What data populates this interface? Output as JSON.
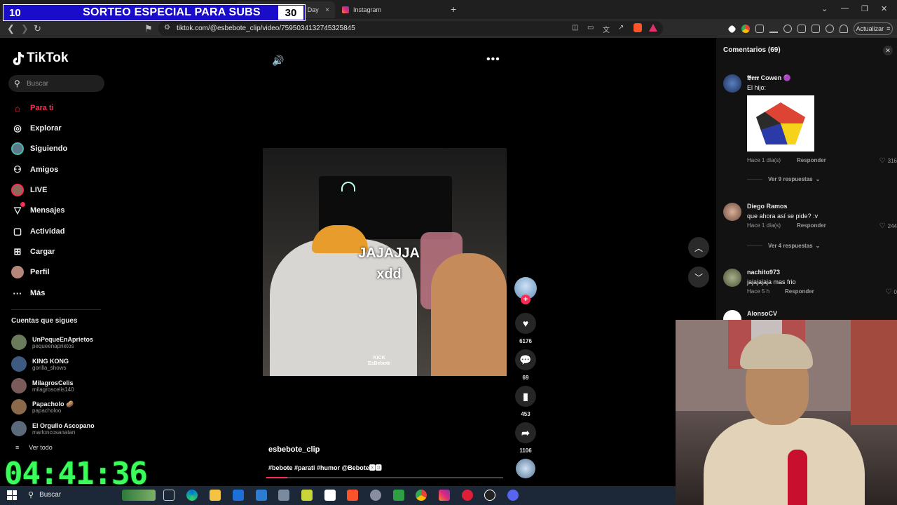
{
  "overlay": {
    "left_number": "10",
    "title": "SORTEO ESPECIAL PARA SUBS",
    "right_number": "30"
  },
  "browser": {
    "tabs": [
      {
        "label": "TikTok - Make Your Day",
        "close": "×",
        "color": "#ffffff"
      },
      {
        "label": "Instagram",
        "close": "",
        "color": "#e1306c"
      }
    ],
    "new_tab": "+",
    "url": "tiktok.com/@esbebote_clip/video/7595034132745325845",
    "update_button": "Actualizar"
  },
  "tiktok": {
    "logo_text": "TikTok",
    "search_placeholder": "Buscar",
    "menu": [
      {
        "label": "Para ti",
        "icon": "home-icon",
        "glyph": "⌂"
      },
      {
        "label": "Explorar",
        "icon": "compass-icon",
        "glyph": "◎"
      },
      {
        "label": "Siguiendo",
        "icon": "avatar-icon",
        "glyph": ""
      },
      {
        "label": "Amigos",
        "icon": "friends-icon",
        "glyph": "⚇"
      },
      {
        "label": "LIVE",
        "icon": "live-avatar-icon",
        "glyph": ""
      },
      {
        "label": "Mensajes",
        "icon": "messages-icon",
        "glyph": "▽"
      },
      {
        "label": "Actividad",
        "icon": "activity-icon",
        "glyph": "▢"
      },
      {
        "label": "Cargar",
        "icon": "upload-icon",
        "glyph": "⊞"
      },
      {
        "label": "Perfil",
        "icon": "profile-icon",
        "glyph": ""
      },
      {
        "label": "Más",
        "icon": "more-icon",
        "glyph": "···"
      }
    ],
    "following_title": "Cuentas que sigues",
    "following": [
      {
        "name": "UnPequeEnAprietos",
        "handle": "pequeenaprietos",
        "color": "#6b7a5a"
      },
      {
        "name": "KING KONG",
        "handle": "gorilla_shows",
        "color": "#3d5a80"
      },
      {
        "name": "MilagrosCelis",
        "handle": "milagroscelis140",
        "color": "#7a5a5a"
      },
      {
        "name": "Papacholo 🥔",
        "handle": "papacholoo",
        "color": "#8a6a4a"
      },
      {
        "name": "El Orgullo Ascopano",
        "handle": "marloncosanatan",
        "color": "#5a6a7a"
      }
    ],
    "see_all": "Ver todo"
  },
  "timer": "04:41:36",
  "video": {
    "caption_line1": "JAJAJJA",
    "caption_line2": "xdd",
    "watermark_line1": "KICK",
    "watermark_line2": "EsBebote",
    "username": "esbebote_clip",
    "description": "#bebote #parati #humor @Bebote🆇🅳",
    "progress": 0.09,
    "likes": "6176",
    "comments": "69",
    "saves": "453",
    "shares": "1106"
  },
  "comments_panel": {
    "title": "Comentarios (69)",
    "comments": [
      {
        "name": "𝕭𝖗𝖗𝖗 Cowen 🟣",
        "text": "El hijo:",
        "time": "Hace 1 día(s)",
        "reply": "Responder",
        "likes": "316",
        "replies": "Ver 9 respuestas"
      },
      {
        "name": "Diego Ramos",
        "text": "que ahora así se pide? :v",
        "time": "Hace 1 día(s)",
        "reply": "Responder",
        "likes": "244",
        "replies": "Ver 4 respuestas"
      },
      {
        "name": "nachito973",
        "text": "jajajajaja mas frio",
        "time": "Hace 5 h",
        "reply": "Responder",
        "likes": "0",
        "replies": ""
      },
      {
        "name": "AlonsoCV",
        "text": "",
        "time": "",
        "reply": "",
        "likes": "",
        "replies": ""
      }
    ]
  },
  "taskbar": {
    "search_label": "Buscar"
  },
  "colors": {
    "accent": "#fe2c55",
    "timer": "#3aff5a",
    "overlay_bg": "#1a0dc9"
  }
}
